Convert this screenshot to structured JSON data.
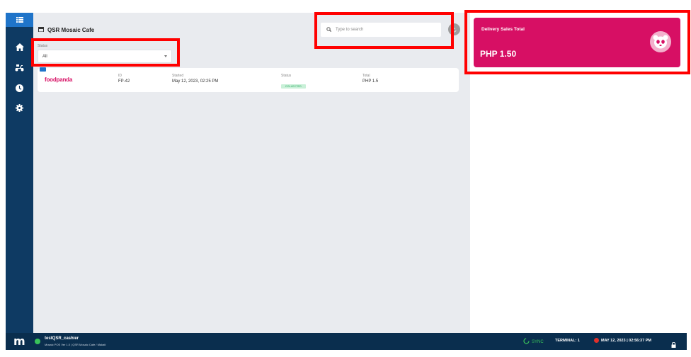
{
  "colors": {
    "sidebar_bg": "#0e3a63",
    "sidebar_accent": "#1f74c9",
    "main_bg": "#e9ebef",
    "foodpanda_pink": "#d70f64",
    "bottom_bar_bg": "#0a2e4e",
    "online_green": "#39c25a",
    "highlight_red": "#ff0000"
  },
  "sidebar": {
    "icons": [
      "menu-grid-icon",
      "home-icon",
      "delivery-scooter-icon",
      "clock-icon",
      "gear-icon"
    ]
  },
  "header": {
    "store_icon": "store-icon",
    "store_name": "QSR Mosaic Cafe"
  },
  "filter": {
    "label": "Status",
    "value": "All"
  },
  "search": {
    "placeholder": "Type to search"
  },
  "orders": {
    "columns": [
      "ID",
      "Started",
      "Status",
      "Total"
    ],
    "rows": [
      {
        "platform": "foodpanda",
        "id": "FP-42",
        "started": "May 12, 2023, 02:25 PM",
        "status": "COLLECTED",
        "total": "PHP 1.5"
      }
    ]
  },
  "sales_card": {
    "title": "Delivery Sales Total",
    "value": "PHP 1.50",
    "icon": "panda-icon"
  },
  "footer": {
    "logo": "m",
    "user": "testQSR_cashier",
    "subtitle": "Mosaic POS Ver 1.0 | QSR Mosaic Cafe / Makati",
    "sync_label": "SYNC",
    "terminal": "TERMINAL: 1",
    "datetime": "MAY 12, 2023 | 02:56:37 PM"
  }
}
